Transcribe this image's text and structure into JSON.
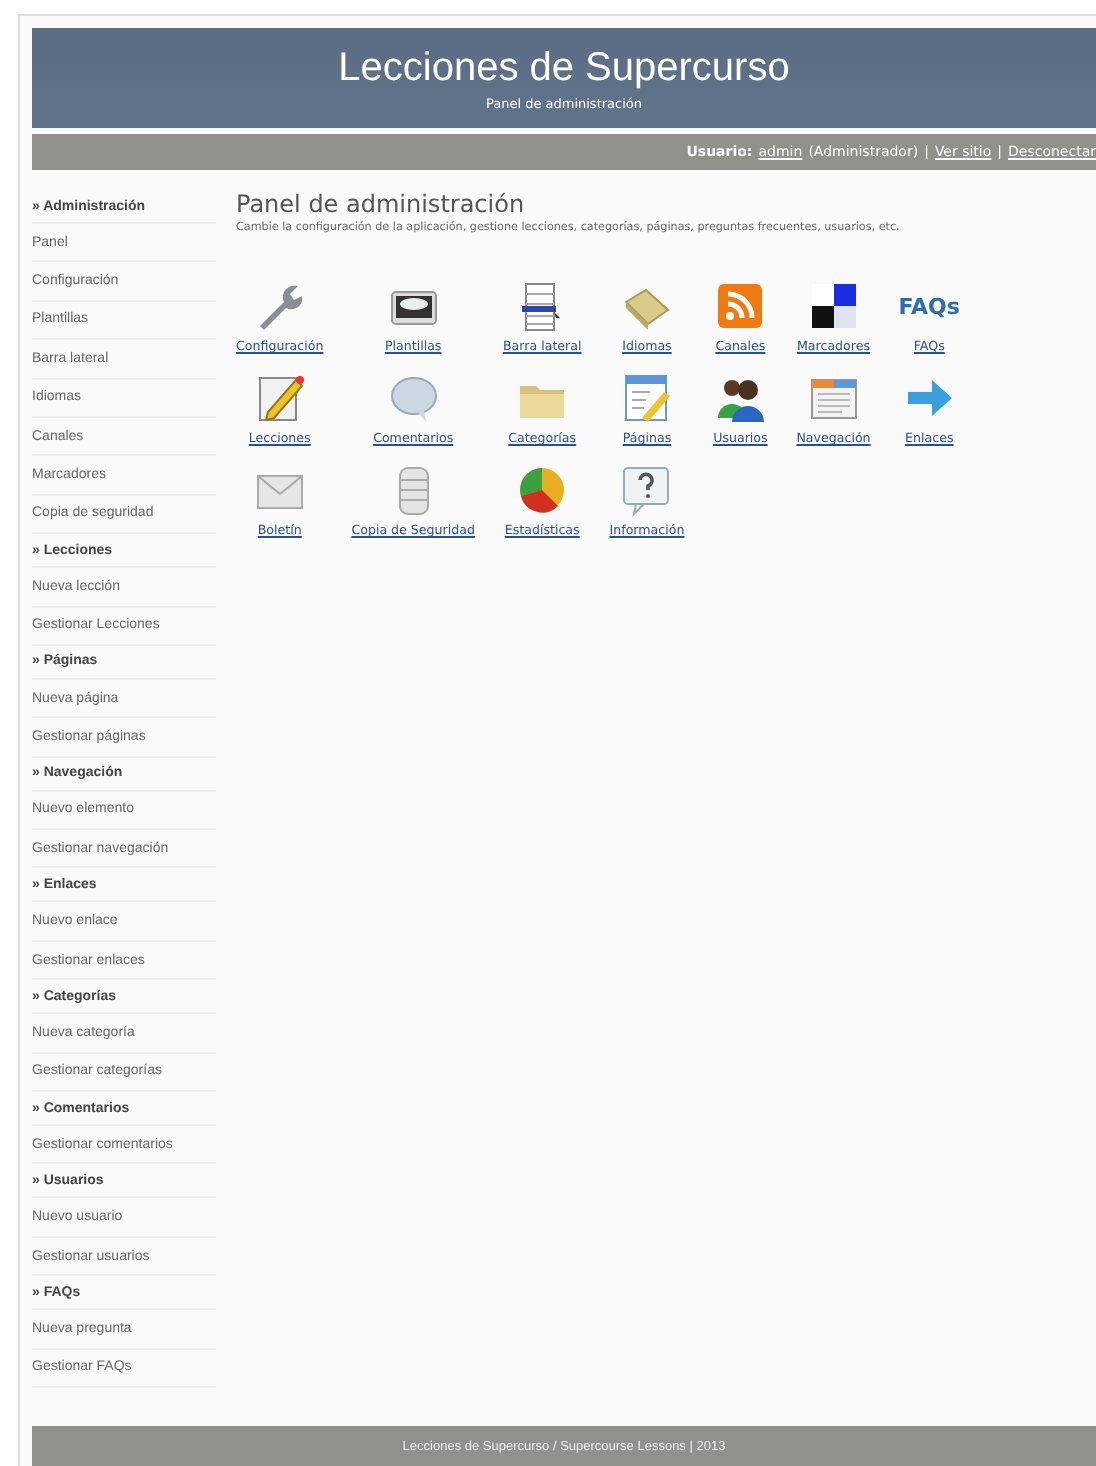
{
  "header": {
    "title": "Lecciones de Supercurso",
    "subtitle": "Panel de administración"
  },
  "user_bar": [
    {
      "kind": "label",
      "text": "Usuario:"
    },
    {
      "kind": "link",
      "text": "admin"
    },
    {
      "kind": "text",
      "text": "(Administrador)"
    },
    {
      "kind": "text",
      "text": "|"
    },
    {
      "kind": "link",
      "text": "Ver sitio"
    },
    {
      "kind": "text",
      "text": "|"
    },
    {
      "kind": "link",
      "text": "Desconectar"
    }
  ],
  "sidebar": [
    {
      "heading": "» Administración",
      "items": [
        "Panel",
        "Configuración",
        "Plantillas",
        "Barra lateral",
        "Idiomas",
        "Canales",
        "Marcadores",
        "Copia de seguridad"
      ]
    },
    {
      "heading": "» Lecciones",
      "items": [
        "Nueva lección",
        "Gestionar Lecciones"
      ]
    },
    {
      "heading": "» Páginas",
      "items": [
        "Nueva página",
        "Gestionar páginas"
      ]
    },
    {
      "heading": "» Navegación",
      "items": [
        "Nuevo elemento",
        "Gestionar navegación"
      ]
    },
    {
      "heading": "» Enlaces",
      "items": [
        "Nuevo enlace",
        "Gestionar enlaces"
      ]
    },
    {
      "heading": "» Categorías",
      "items": [
        "Nueva categoría",
        "Gestionar categorías"
      ]
    },
    {
      "heading": "» Comentarios",
      "items": [
        "Gestionar comentarios"
      ]
    },
    {
      "heading": "» Usuarios",
      "items": [
        "Nuevo usuario",
        "Gestionar usuarios"
      ]
    },
    {
      "heading": "» FAQs",
      "items": [
        "Nueva pregunta",
        "Gestionar FAQs"
      ]
    }
  ],
  "content": {
    "title": "Panel de administración",
    "description": "Cambie la configuración de la aplicación, gestione lecciones, categorías, páginas, preguntas frecuentes, usuarios, etc.",
    "shortcuts": [
      {
        "label": "Configuración"
      },
      {
        "label": "Plantillas"
      },
      {
        "label": "Barra lateral"
      },
      {
        "label": "Idiomas"
      },
      {
        "label": "Canales"
      },
      {
        "label": "Marcadores"
      },
      {
        "label": "FAQs",
        "icon_text": "FAQs"
      },
      {
        "label": "Lecciones"
      },
      {
        "label": "Comentarios"
      },
      {
        "label": "Categorías"
      },
      {
        "label": "Páginas"
      },
      {
        "label": "Usuarios"
      },
      {
        "label": "Navegación"
      },
      {
        "label": "Enlaces"
      },
      {
        "label": "Boletín"
      },
      {
        "label": "Copia de Seguridad"
      },
      {
        "label": "Estadísticas"
      },
      {
        "label": "Información"
      }
    ]
  },
  "footer": "Lecciones de Supercurso / Supercourse Lessons | 2013"
}
